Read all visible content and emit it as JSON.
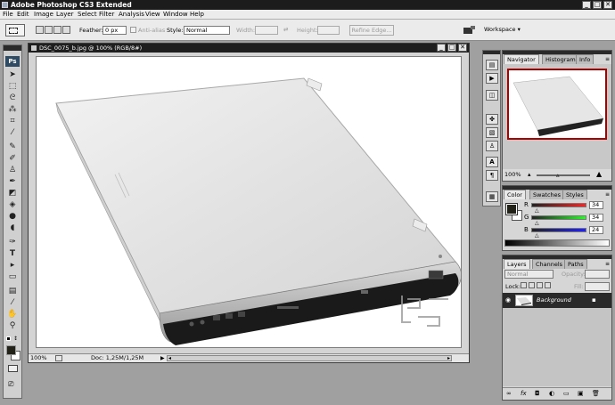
{
  "app": {
    "title": "Adobe Photoshop CS3 Extended",
    "min": "_",
    "max": "□",
    "close": "✕"
  },
  "menu": [
    "File",
    "Edit",
    "Image",
    "Layer",
    "Select",
    "Filter",
    "Analysis",
    "View",
    "Window",
    "Help"
  ],
  "options": {
    "feather_label": "Feather:",
    "feather_value": "0 px",
    "antialias_label": "Anti-alias",
    "style_label": "Style:",
    "style_value": "Normal",
    "width_label": "Width:",
    "height_label": "Height:",
    "refine_edge": "Refine Edge...",
    "workspace": "Workspace ▾"
  },
  "toolbox": {
    "logo": "Ps"
  },
  "document": {
    "title": "DSC_0075_b.jpg @ 100% (RGB/8#)",
    "zoom": "100%",
    "doc_size": "Doc: 1,25M/1,25M"
  },
  "navigator": {
    "tabs": [
      "Navigator",
      "Histogram",
      "Info"
    ],
    "zoom": "100%"
  },
  "color": {
    "tabs": [
      "Color",
      "Swatches",
      "Styles"
    ],
    "channels": [
      {
        "label": "R",
        "value": "34"
      },
      {
        "label": "G",
        "value": "34"
      },
      {
        "label": "B",
        "value": "24"
      }
    ]
  },
  "layers": {
    "tabs": [
      "Layers",
      "Channels",
      "Paths"
    ],
    "blend_mode": "Normal",
    "opacity_label": "Opacity:",
    "lock_label": "Lock:",
    "fill_label": "Fill:",
    "layer_name": "Background"
  }
}
